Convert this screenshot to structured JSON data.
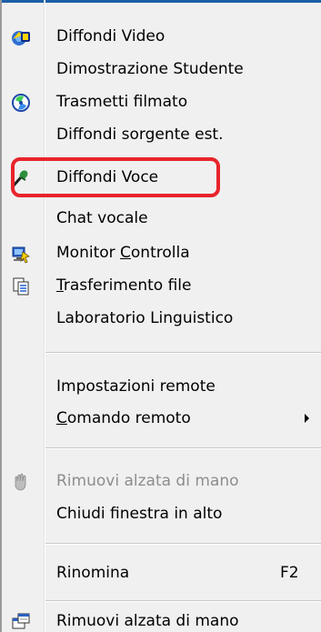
{
  "menu": {
    "items": [
      {
        "label": "Diffondi Video",
        "icon": "broadcast-video-icon"
      },
      {
        "label": "Dimostrazione Studente"
      },
      {
        "label": "Trasmetti filmato",
        "icon": "disc-icon"
      },
      {
        "label": "Diffondi sorgente est."
      },
      {
        "label": "Diffondi Voce",
        "icon": "microphone-icon"
      },
      {
        "label": "Chat vocale"
      },
      {
        "label_pre": "Monitor ",
        "label_ul": "C",
        "label_post": "ontrolla",
        "icon": "monitor-control-icon"
      },
      {
        "label_pre": "",
        "label_ul": "T",
        "label_post": "rasferimento file",
        "icon": "file-transfer-icon"
      },
      {
        "label": "Laboratorio Linguistico"
      },
      {
        "label": "Impostazioni remote"
      },
      {
        "label_pre": "",
        "label_ul": "C",
        "label_post": "omando remoto",
        "submenu": true
      },
      {
        "label": "Rimuovi alzata di mano",
        "icon": "raised-hand-icon",
        "disabled": true
      },
      {
        "label": "Chiudi finestra in alto"
      },
      {
        "label": "Rinomina",
        "shortcut": "F2"
      },
      {
        "label": "Rimuovi alzata di mano",
        "icon": "properties-icon"
      }
    ]
  },
  "colors": {
    "menu_background": "#f0f0f0",
    "highlight_border": "#e8242a",
    "disabled_text": "#8d8d8d"
  }
}
